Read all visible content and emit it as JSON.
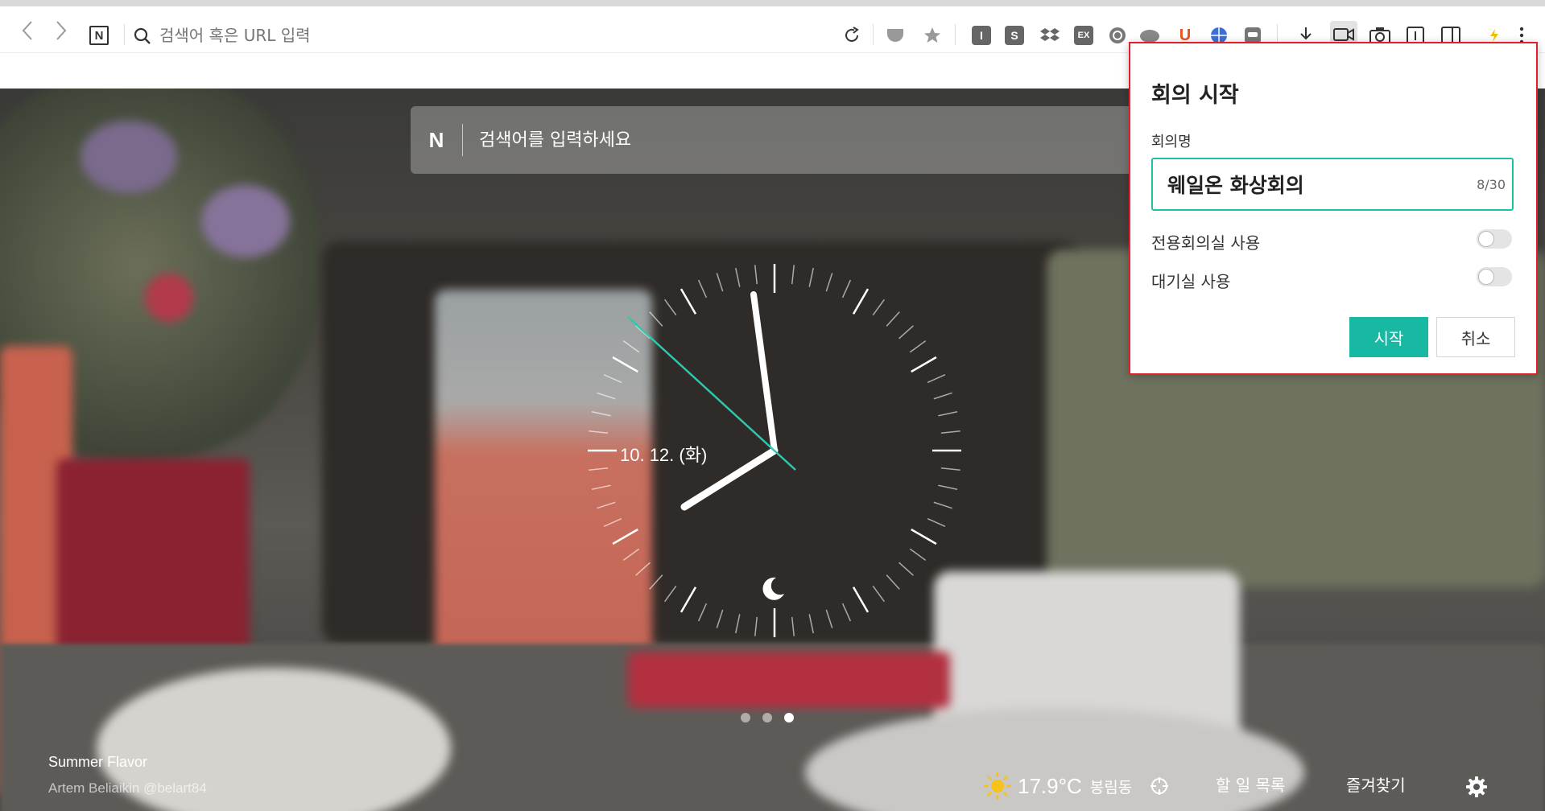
{
  "browser": {
    "url_placeholder": "검색어 혹은 URL 입력",
    "nav": {
      "back_icon": "chevron-left-icon",
      "forward_icon": "chevron-right-icon",
      "home_label": "N"
    },
    "extensions": [
      {
        "name": "ext-i",
        "label": "I"
      },
      {
        "name": "ext-s",
        "label": "S"
      },
      {
        "name": "ext-ex",
        "label": "EX"
      },
      {
        "name": "ext-u",
        "label": "U"
      }
    ]
  },
  "newtab": {
    "search_logo": "N",
    "search_placeholder": "검색어를 입력하세요",
    "clock_date": "10. 12. (화)",
    "slides": {
      "count": 3,
      "active": 3
    },
    "credit": {
      "title": "Summer Flavor",
      "author": "Artem Beliaikin @belart84"
    },
    "weather": {
      "temperature": "17.9°C",
      "location": "봉림동",
      "icon": "sun-icon"
    },
    "links": {
      "todo": "할 일 목록",
      "bookmarks": "즐겨찾기"
    }
  },
  "meeting_popup": {
    "title": "회의 시작",
    "name_label": "회의명",
    "name_value": "웨일온 화상회의",
    "name_counter": "8/30",
    "options": [
      {
        "label": "전용회의실 사용",
        "enabled": false
      },
      {
        "label": "대기실 사용",
        "enabled": false
      }
    ],
    "start_label": "시작",
    "cancel_label": "취소"
  },
  "colors": {
    "accent": "#19b8a2",
    "highlight_border": "#e0202a",
    "ext_u": "#e8541c"
  }
}
